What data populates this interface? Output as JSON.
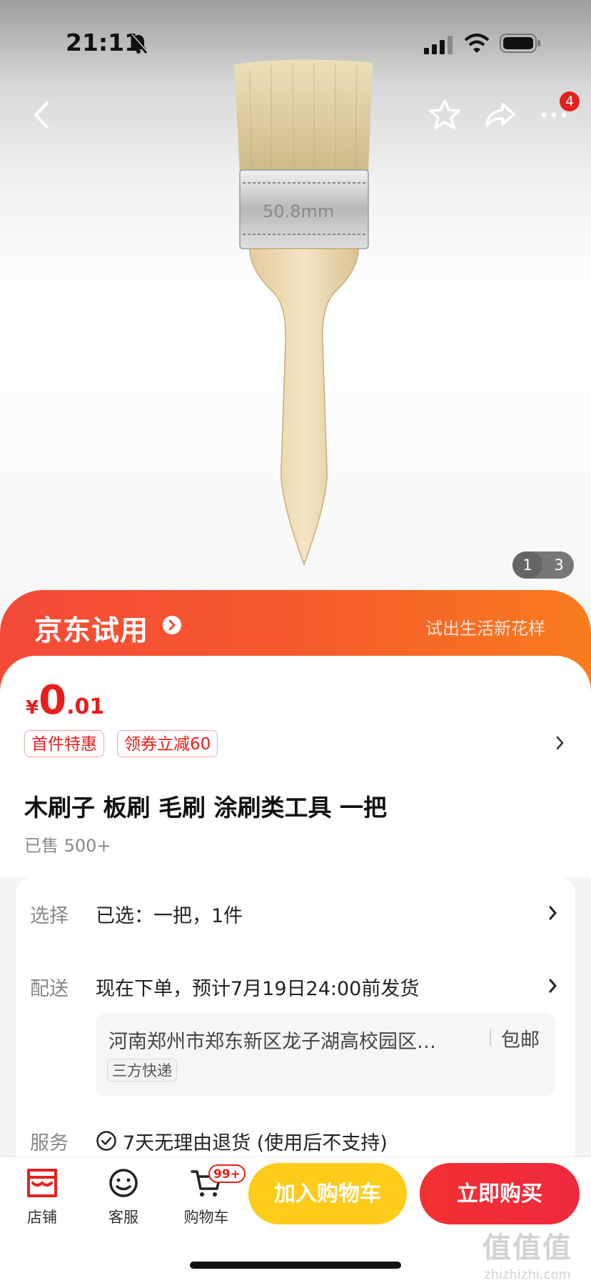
{
  "status_bar": {
    "time": "21:11"
  },
  "header": {
    "more_badge": "4",
    "pager": {
      "current": "1",
      "total": "3"
    }
  },
  "trial_banner": {
    "title": "京东试用",
    "slogan": "试出生活新花样"
  },
  "price": {
    "symbol": "¥",
    "integer": "0",
    "decimal": ".01"
  },
  "tags": [
    "首件特惠",
    "领券立减60"
  ],
  "product": {
    "title": "木刷子 板刷 毛刷 涂刷类工具 一把",
    "sold": "已售 500+",
    "brush_stamp": "50.8mm"
  },
  "info": {
    "select": {
      "label": "选择",
      "value": "已选：一把，1件"
    },
    "delivery": {
      "label": "配送",
      "value": "现在下单，预计7月19日24:00前发货"
    },
    "address": {
      "text": "河南郑州市郑东新区龙子湖高校园区…",
      "shipping": "包邮",
      "courier": "三方快递"
    },
    "service": {
      "label": "服务",
      "value": "7天无理由退货 (使用后不支持)"
    }
  },
  "bottom_bar": {
    "tabs": [
      {
        "label": "店铺"
      },
      {
        "label": "客服"
      },
      {
        "label": "购物车"
      }
    ],
    "cart_badge": "99+",
    "add_cart": "加入购物车",
    "buy_now": "立即购买"
  },
  "watermark": {
    "logo": "值值值",
    "url": "zhizhizhi.com"
  },
  "colors": {
    "accent_red": "#e4201e",
    "cart_yellow": "#fdcb1a",
    "banner_orange": "#f87c1e"
  }
}
